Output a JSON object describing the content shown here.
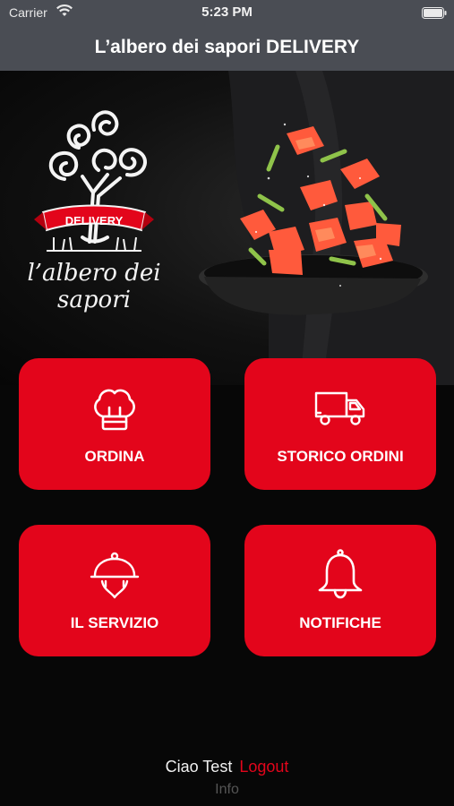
{
  "status_bar": {
    "carrier": "Carrier",
    "time": "5:23 PM",
    "icons": [
      "wifi-icon",
      "battery-icon"
    ]
  },
  "nav": {
    "title": "L’albero dei sapori DELIVERY"
  },
  "logo": {
    "ribbon_text": "DELIVERY",
    "line1": "l’albero dei",
    "line2": "sapori"
  },
  "tiles": [
    {
      "label": "ORDINA",
      "icon": "chef-hat-icon"
    },
    {
      "label": "STORICO ORDINI",
      "icon": "delivery-truck-icon"
    },
    {
      "label": "IL SERVIZIO",
      "icon": "serving-cloche-icon"
    },
    {
      "label": "NOTIFICHE",
      "icon": "bell-icon"
    }
  ],
  "footer": {
    "greeting": "Ciao Test",
    "logout_label": "Logout",
    "info_label": "Info"
  },
  "colors": {
    "accent": "#e3051b",
    "header_bg": "#4a4d54",
    "page_bg": "#070707"
  }
}
